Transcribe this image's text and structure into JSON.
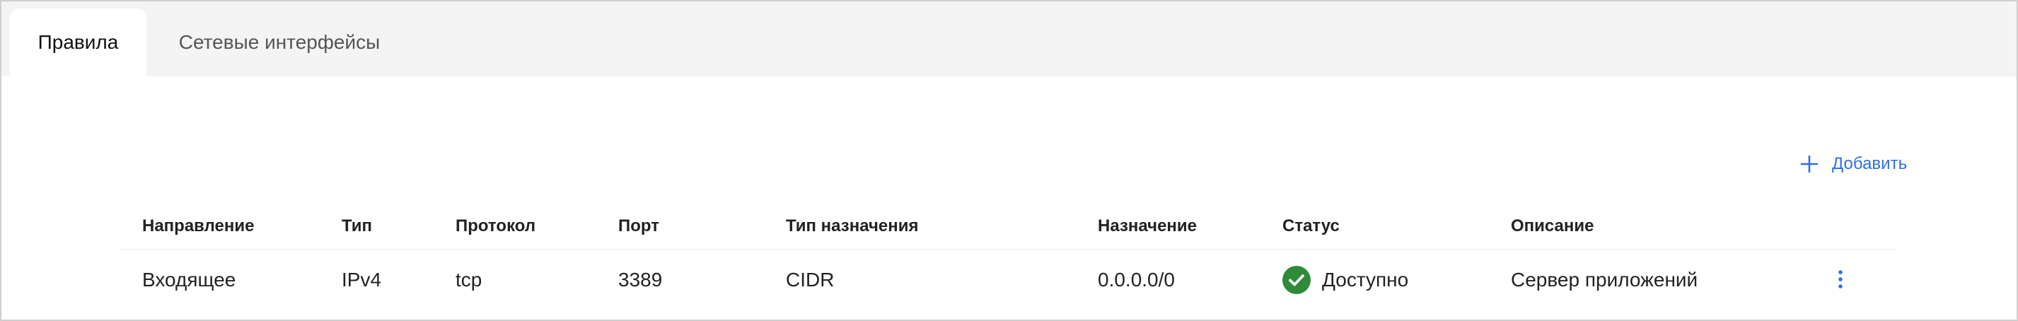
{
  "tabs": {
    "rules": "Правила",
    "interfaces": "Сетевые интерфейсы"
  },
  "actions": {
    "add_label": "Добавить"
  },
  "table": {
    "columns": [
      "Направление",
      "Тип",
      "Протокол",
      "Порт",
      "Тип назначения",
      "Назначение",
      "Статус",
      "Описание"
    ],
    "rows": [
      {
        "direction": "Входящее",
        "type": "IPv4",
        "protocol": "tcp",
        "port": "3389",
        "destination_type": "CIDR",
        "destination": "0.0.0.0/0",
        "status": "Доступно",
        "description": "Сервер приложений"
      }
    ]
  },
  "icons": {
    "add": "plus-icon",
    "status": "check-circle-icon",
    "menu": "more-vertical-icon"
  },
  "colors": {
    "accent": "#2f6fe4",
    "success": "#2f8a3a",
    "tab_background": "#f4f4f4"
  }
}
